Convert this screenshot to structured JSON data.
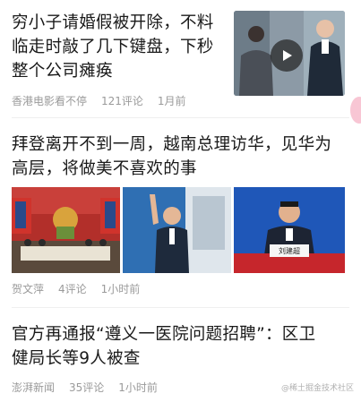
{
  "articles": [
    {
      "title_line1": "穷小子请婚假被开除，不料",
      "title_line2": "临走时敲了几下键盘，下秒",
      "title_line3": "整个公司瘫痪",
      "source": "香港电影看不停",
      "comments": "121评论",
      "time": "1月前",
      "has_video": true
    },
    {
      "title_line1": "拜登离开不到一周，越南总理访华，见华为",
      "title_line2": "高层，将做美不喜欢的事",
      "source": "贺文萍",
      "comments": "4评论",
      "time": "1小时前",
      "nameplate": "刘建超"
    },
    {
      "title_line1": "官方再通报“遵义一医院问题招聘”：区卫",
      "title_line2": "健局长等9人被查",
      "source": "澎湃新闻",
      "comments": "35评论",
      "time": "1小时前"
    }
  ],
  "watermark": "@稀土掘金技术社区"
}
